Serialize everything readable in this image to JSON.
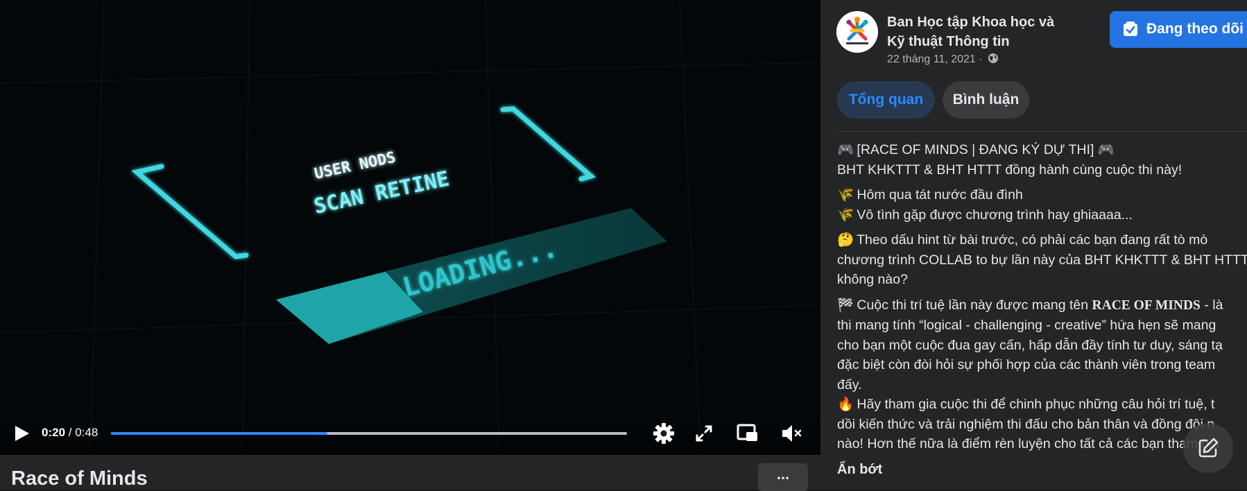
{
  "video": {
    "overlay_text_1": "USER NODS",
    "overlay_text_2": "SCAN RETINE",
    "overlay_text_3": "LOADING...",
    "time_current": "0:20",
    "time_separator": " / ",
    "time_total": "0:48",
    "progress_fraction": 0.42,
    "title": "Race of Minds",
    "more_label": "..."
  },
  "post": {
    "page_name": "Ban Học tập Khoa học và Kỹ thuật Thông tin",
    "date": "22 tháng 11, 2021 ·",
    "follow_label": "Đang theo dõi",
    "tabs": [
      {
        "label": "Tổng quan",
        "active": true
      },
      {
        "label": "Bình luận",
        "active": false
      }
    ],
    "lines": {
      "l1_emoji": "🎮",
      "l1": " [RACE OF MINDS | ĐANG KÝ DỰ THI] ",
      "l1_end": "🎮",
      "l2": "BHT KHKTTT & BHT HTTT đồng hành cùng cuộc thi này!",
      "l3_emoji": "🌾",
      "l3": " Hôm qua tát nước đầu đình",
      "l4_emoji": "🌾",
      "l4": " Vô tình gặp được chương trình hay ghiaaaa...",
      "l5_emoji": "🤔",
      "l5": " Theo dấu hint từ bài trước, có phải các bạn đang rất tò mò",
      "l6": "chương trình COLLAB to bự lần này của BHT KHKTTT & BHT HTTT",
      "l7": "không nào?",
      "l8_emoji": "🏁",
      "l8a": " Cuộc thi trí tuệ lần này được mang tên ",
      "l8b": "RACE OF MINDS",
      "l8c": " - là",
      "l9": "thi mang tính “logical - challenging - creative” hứa hẹn sẽ mang",
      "l10": "cho bạn một cuộc đua gay cấn, hấp dẫn đầy tính tư duy, sáng tạ",
      "l11": "đặc biệt còn đòi hỏi sự phối hợp của các thành viên trong team",
      "l12": "đấy.",
      "l13_emoji": "🔥",
      "l13": " Hãy tham gia cuộc thi để chinh phục những câu hỏi trí tuệ, t",
      "l14": "dồi kiến thức và trải nghiệm thi đấu cho bản thân và đồng đội n",
      "l15": "nào! Hơn thế nữa là điểm rèn luyện cho tất cả các bạn tham gia"
    },
    "see_less": "Ẩn bớt"
  },
  "colors": {
    "accent": "#2d88ff",
    "follow_bg": "#2374e1",
    "panel_bg": "#242526",
    "neon": "#3fd8e0"
  },
  "icons": [
    "play-icon",
    "settings-icon",
    "fullscreen-icon",
    "mini-player-icon",
    "volume-muted-icon",
    "globe-icon",
    "follow-check-icon",
    "compose-icon"
  ]
}
